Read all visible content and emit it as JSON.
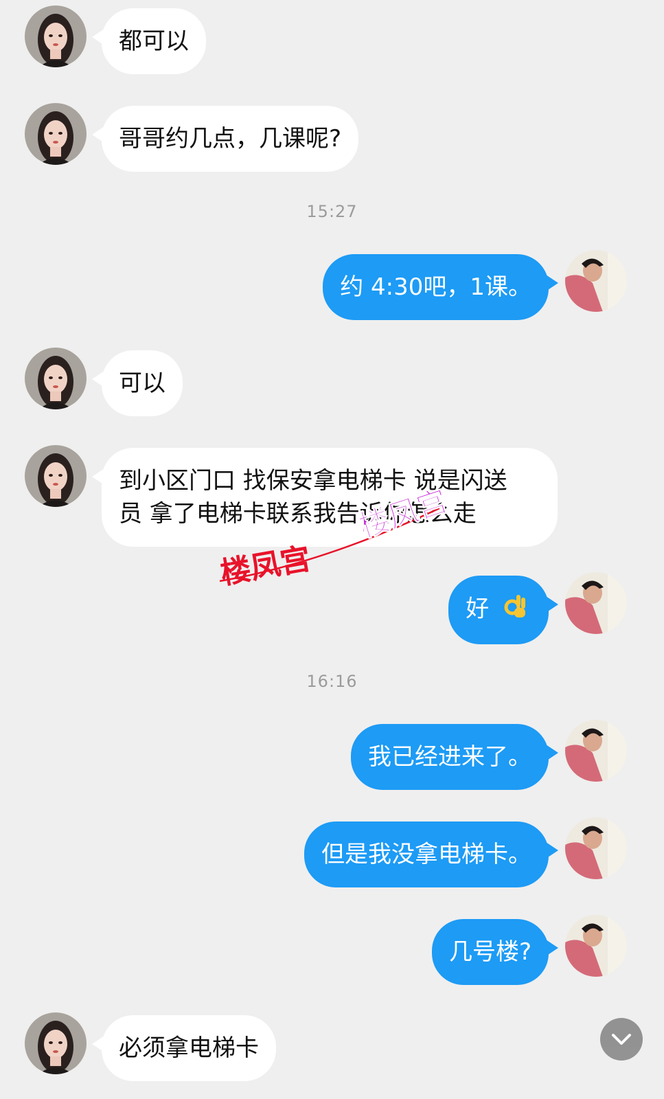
{
  "conversation": {
    "messages": [
      {
        "id": "m1",
        "side": "in",
        "text": "都可以"
      },
      {
        "id": "m2",
        "side": "in",
        "text": "哥哥约几点，几课呢?"
      },
      {
        "id": "m3",
        "side": "out",
        "text": "约 4:30吧，1课。"
      },
      {
        "id": "m4",
        "side": "in",
        "text": "可以"
      },
      {
        "id": "m5",
        "side": "in",
        "lines": [
          "到小区门口 找保安拿电梯卡 说是闪送",
          "员 拿了电梯卡联系我告诉你怎么走"
        ]
      },
      {
        "id": "m6",
        "side": "out",
        "text": "好",
        "emoji": "ok-hand-emoji"
      },
      {
        "id": "m7",
        "side": "out",
        "text": "我已经进来了。"
      },
      {
        "id": "m8",
        "side": "out",
        "text": "但是我没拿电梯卡。"
      },
      {
        "id": "m9",
        "side": "out",
        "text": "几号楼?"
      },
      {
        "id": "m10",
        "side": "in",
        "text": "必须拿电梯卡"
      }
    ],
    "timestamps": {
      "t1": "15:27",
      "t2": "16:16"
    }
  },
  "watermarks": {
    "red": "楼凤宫",
    "purple": "楼凤宫"
  },
  "colors": {
    "background": "#efefef",
    "incoming_bubble": "#ffffff",
    "outgoing_bubble": "#1d9bf5",
    "timestamp": "#9b9b9b",
    "watermark_red": "#e8132a",
    "watermark_purple": "#c51fd6"
  },
  "controls": {
    "scroll_down_icon": "chevron-down-icon"
  }
}
